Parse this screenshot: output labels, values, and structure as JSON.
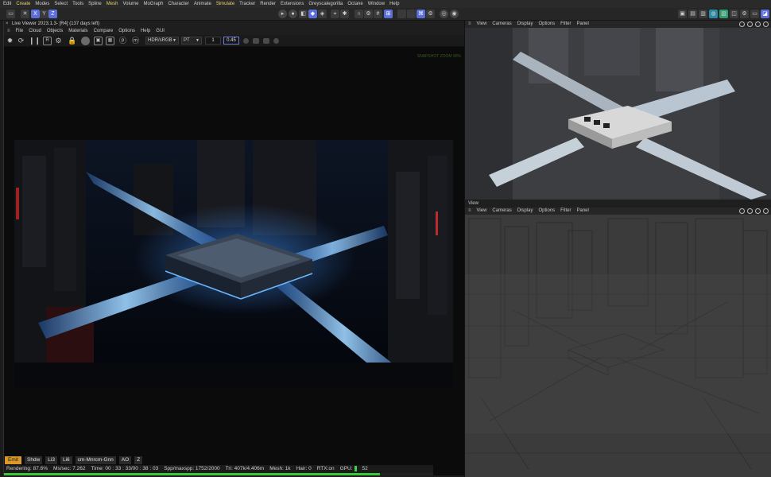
{
  "menubar": {
    "items": [
      "Edit",
      "Create",
      "Modes",
      "Select",
      "Tools",
      "Spline",
      "Mesh",
      "Volume",
      "MoGraph",
      "Character",
      "Animate",
      "Simulate",
      "Tracker",
      "Render",
      "Extensions",
      "Greyscalegorilla",
      "Octane",
      "Window",
      "Help"
    ],
    "highlight": [
      "Create",
      "Mesh",
      "Simulate"
    ],
    "highlight_color": "#e8d36a"
  },
  "toolbar": {
    "axis_x": "X",
    "axis_y": "Y",
    "axis_z": "Z",
    "accent": "#5c6fd8"
  },
  "live_viewer": {
    "title": "Live Viewer 2023.1.3- [R4] (137 days left)",
    "close": "×",
    "menu": [
      "File",
      "Cloud",
      "Objects",
      "Materials",
      "Compare",
      "Options",
      "Help",
      "GUI"
    ],
    "color_space": "HDR/sRGB",
    "kernel": "PT",
    "field_a": "1",
    "field_b": "0.45",
    "watermark": "SNAPSHOT ZOOM 90%",
    "tags": [
      "Emit",
      "Shdw",
      "Li3",
      "Li6",
      "cm-Mnrcm-Gnn",
      "AO",
      "Z"
    ],
    "tag_active": "Emit"
  },
  "status": {
    "rendering": "Rendering: 87.6%",
    "ms_sec": "Ms/sec: 7.262",
    "time": "Time: 00 : 33 : 33/00 : 38 : 03",
    "spp": "Spp/maxspp: 1752/2000",
    "tri": "Tri: 407k/4.406m",
    "mesh": "Mesh: 1k",
    "hair": "Hair: 0",
    "rtx": "RTX:on",
    "gpu": "GPU:",
    "gpu_value": "52",
    "progress": 0.876,
    "progress_color": "#38c93a"
  },
  "viewport_top": {
    "menu": [
      "View",
      "Cameras",
      "Display",
      "Options",
      "Filter",
      "Panel"
    ]
  },
  "viewport_bottom": {
    "title": "View",
    "menu": [
      "View",
      "Cameras",
      "Display",
      "Options",
      "Filter",
      "Panel"
    ]
  }
}
